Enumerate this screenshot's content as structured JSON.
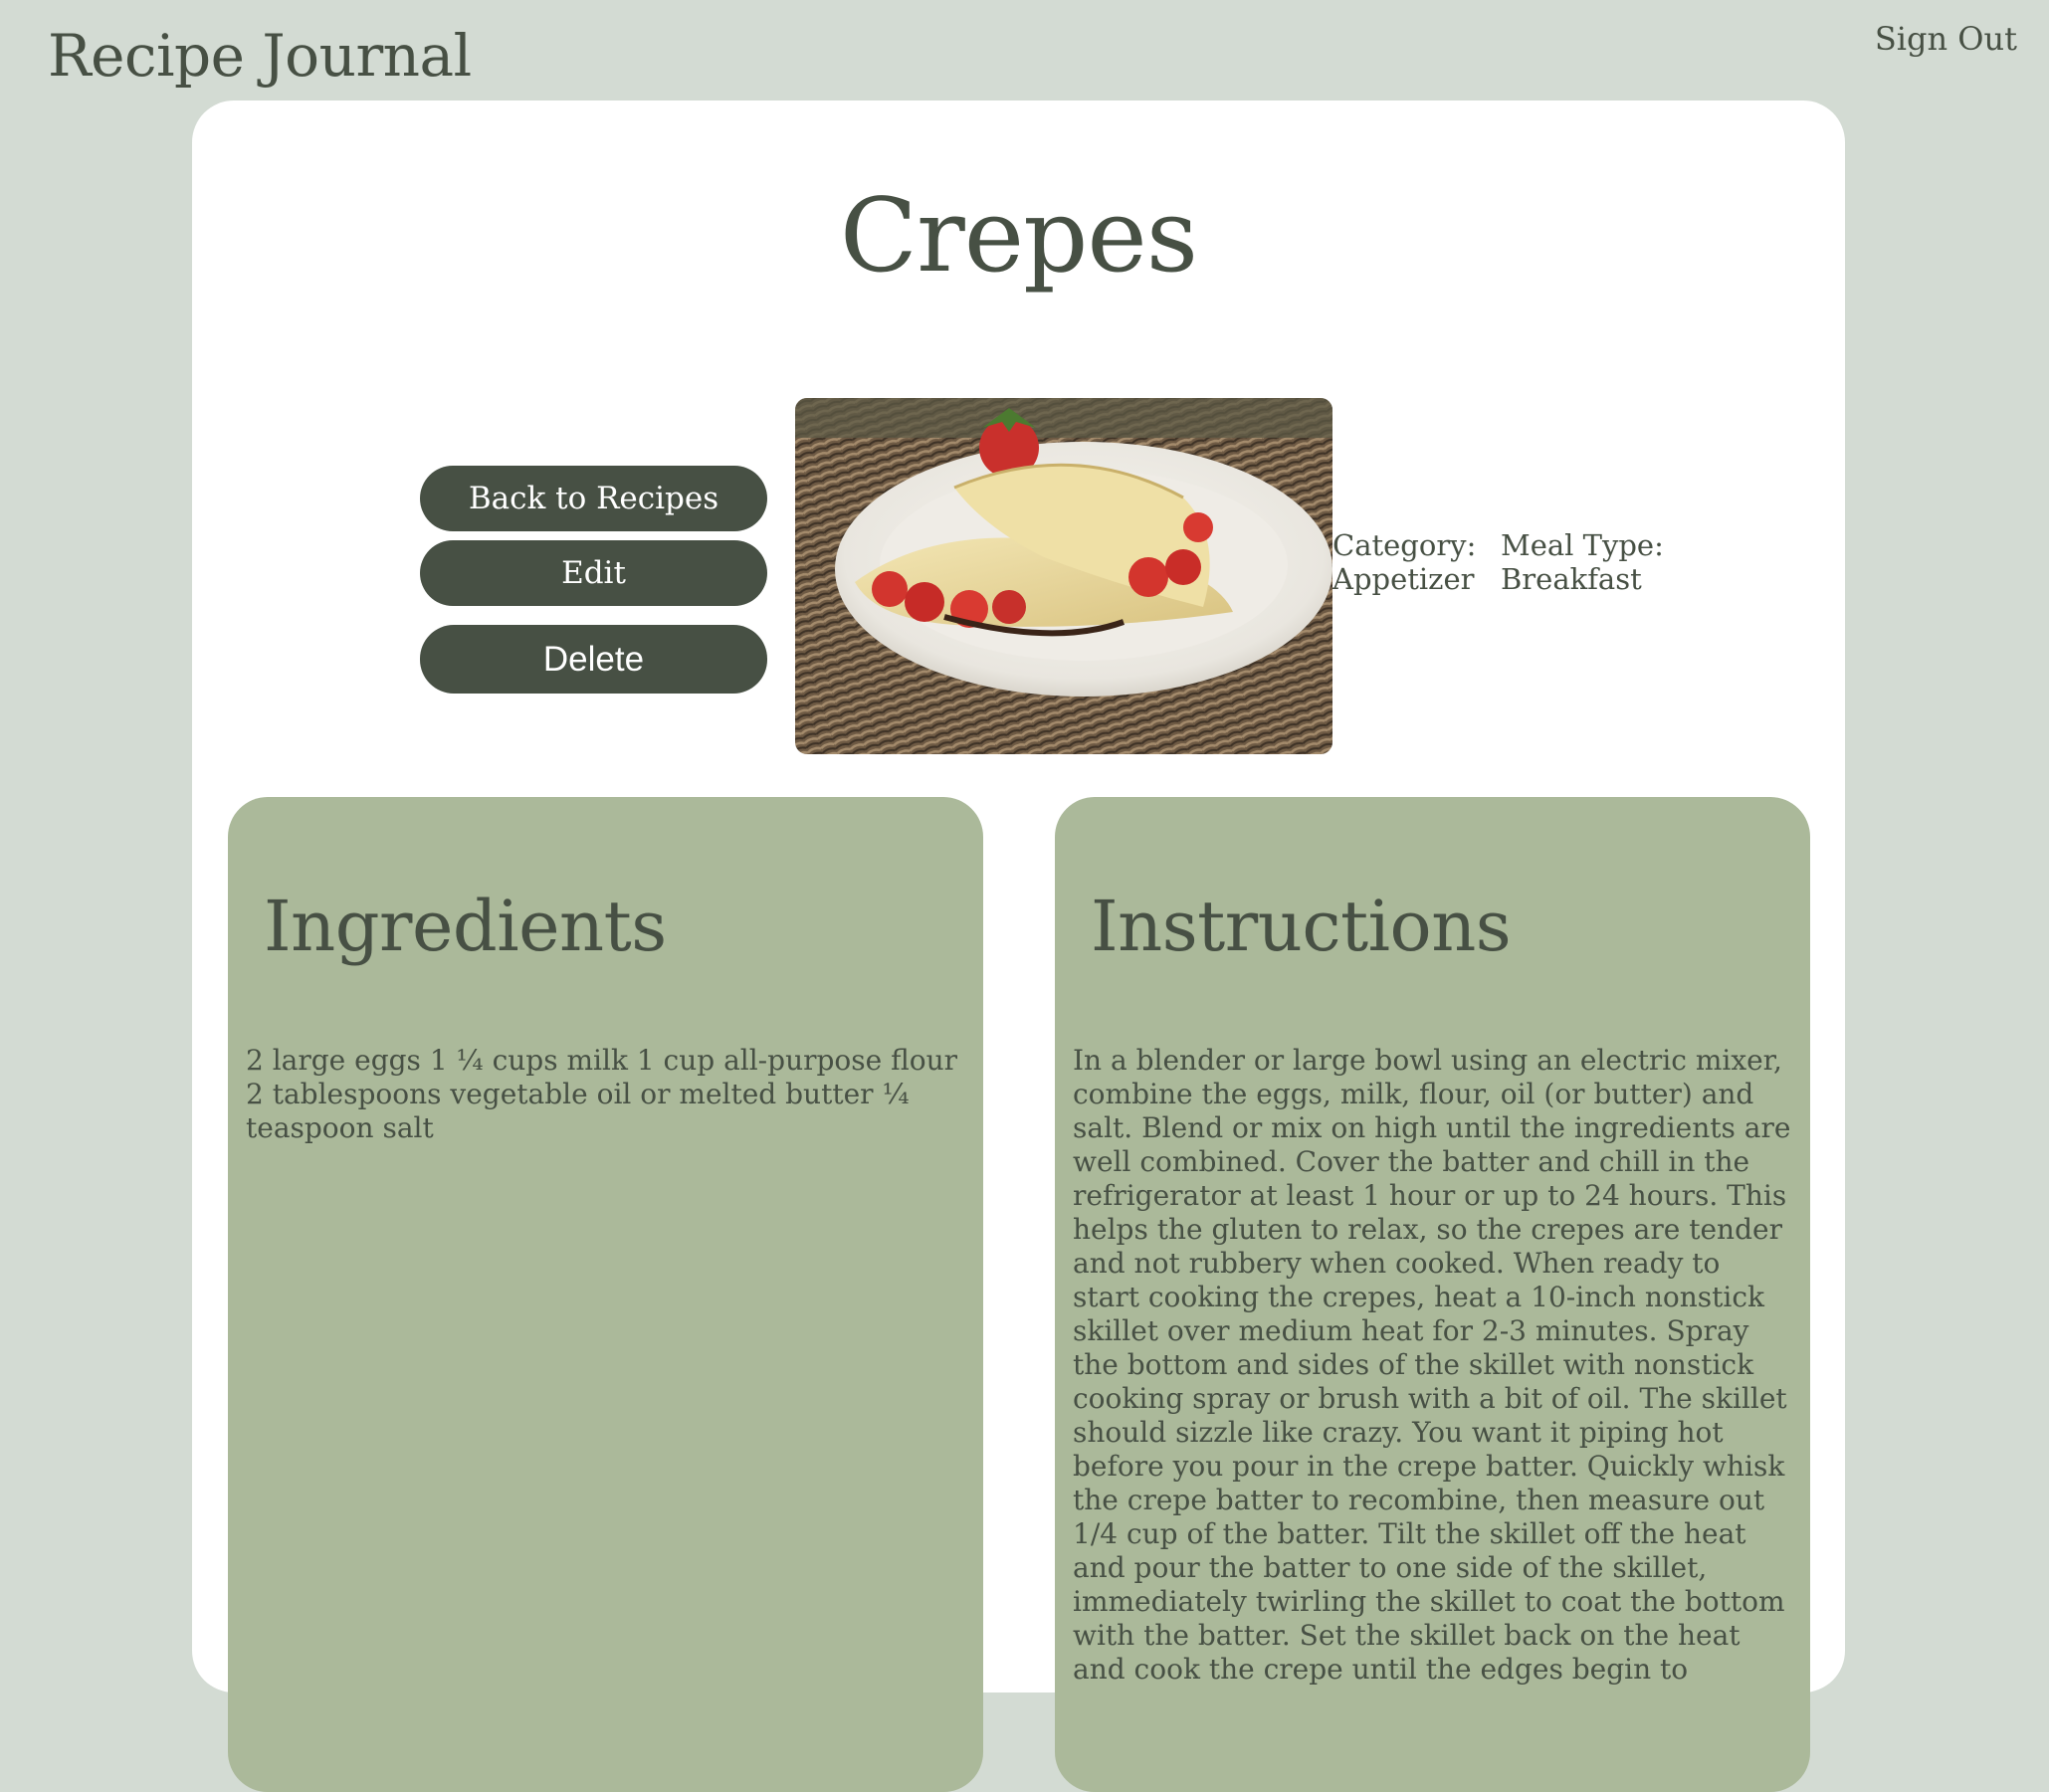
{
  "header": {
    "app_title": "Recipe Journal",
    "sign_out_label": "Sign Out"
  },
  "recipe": {
    "title": "Crepes",
    "image_alt": "Crepes with strawberries on a white plate",
    "category_label": "Category:",
    "category_value": "Appetizer",
    "meal_type_label": "Meal Type:",
    "meal_type_value": "Breakfast"
  },
  "actions": {
    "back_label": "Back to Recipes",
    "edit_label": "Edit",
    "delete_label": "Delete"
  },
  "ingredients": {
    "heading": "Ingredients",
    "text": "2 large eggs 1 ¼ cups milk 1 cup all-purpose flour 2 tablespoons vegetable oil or melted butter ¼ teaspoon salt"
  },
  "instructions": {
    "heading": "Instructions",
    "text": "In a blender or large bowl using an electric mixer, combine the eggs, milk, flour, oil (or butter) and salt. Blend or mix on high until the ingredients are well combined. Cover the batter and chill in the refrigerator at least 1 hour or up to 24 hours. This helps the gluten to relax, so the crepes are tender and not rubbery when cooked. When ready to start cooking the crepes, heat a 10-inch nonstick skillet over medium heat for 2-3 minutes. Spray the bottom and sides of the skillet with nonstick cooking spray or brush with a bit of oil. The skillet should sizzle like crazy. You want it piping hot before you pour in the crepe batter. Quickly whisk the crepe batter to recombine, then measure out 1/4 cup of the batter. Tilt the skillet off the heat and pour the batter to one side of the skillet, immediately twirling the skillet to coat the bottom with the batter. Set the skillet back on the heat and cook the crepe until the edges begin to"
  },
  "colors": {
    "page_background": "#d3dbd3",
    "card_background": "#ffffff",
    "panel_background": "#abb99a",
    "primary_dark": "#475044",
    "button_text": "#ffffff"
  }
}
